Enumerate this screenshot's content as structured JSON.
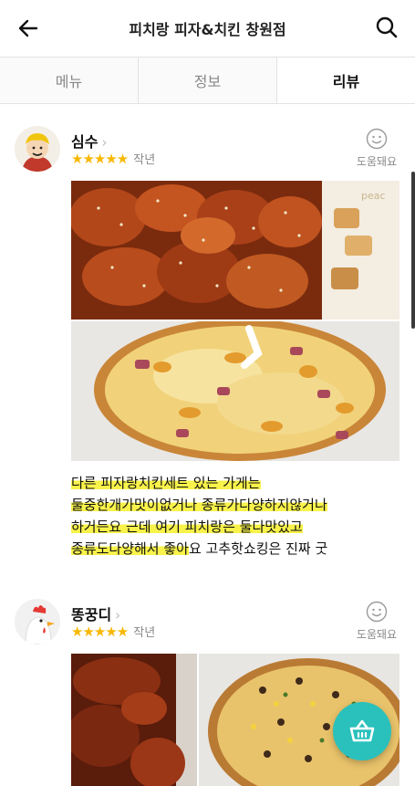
{
  "header": {
    "title": "피치랑 피자&치킨 창원점",
    "back_icon": "arrow-left-icon",
    "search_icon": "search-icon"
  },
  "tabs": [
    {
      "label": "메뉴",
      "active": false
    },
    {
      "label": "정보",
      "active": false
    },
    {
      "label": "리뷰",
      "active": true
    }
  ],
  "reviews": [
    {
      "author": "심수",
      "rating": 5,
      "stars": "★★★★★",
      "date": "작년",
      "helpful_label": "도움돼요",
      "text_segments": [
        {
          "text": "다른 피자랑치킨세트 있는 가게는",
          "highlight": true
        },
        {
          "text": "둘중한개가맛이없거나 종류가다양하지않거나",
          "highlight": true
        },
        {
          "text": "하거든요 근데 여기 피치랑은 둘다맛있고",
          "highlight": true
        },
        {
          "text": "종류도다양해서 좋아",
          "highlight": true
        },
        {
          "text": "요 고추핫쇼킹은 진짜 굿",
          "highlight": false
        }
      ],
      "photos": [
        "sweet-chili-fried-chicken-photo",
        "cheese-pizza-photo"
      ]
    },
    {
      "author": "똥꿍디",
      "rating": 5,
      "stars": "★★★★★",
      "date": "작년",
      "helpful_label": "도움돼요",
      "photos": [
        "fried-chicken-photo",
        "combination-pizza-photo"
      ]
    }
  ],
  "fab": {
    "icon": "shopping-basket-icon"
  },
  "colors": {
    "accent": "#2ac1bc",
    "star": "#f7b801",
    "highlight": "#f8f24a"
  }
}
